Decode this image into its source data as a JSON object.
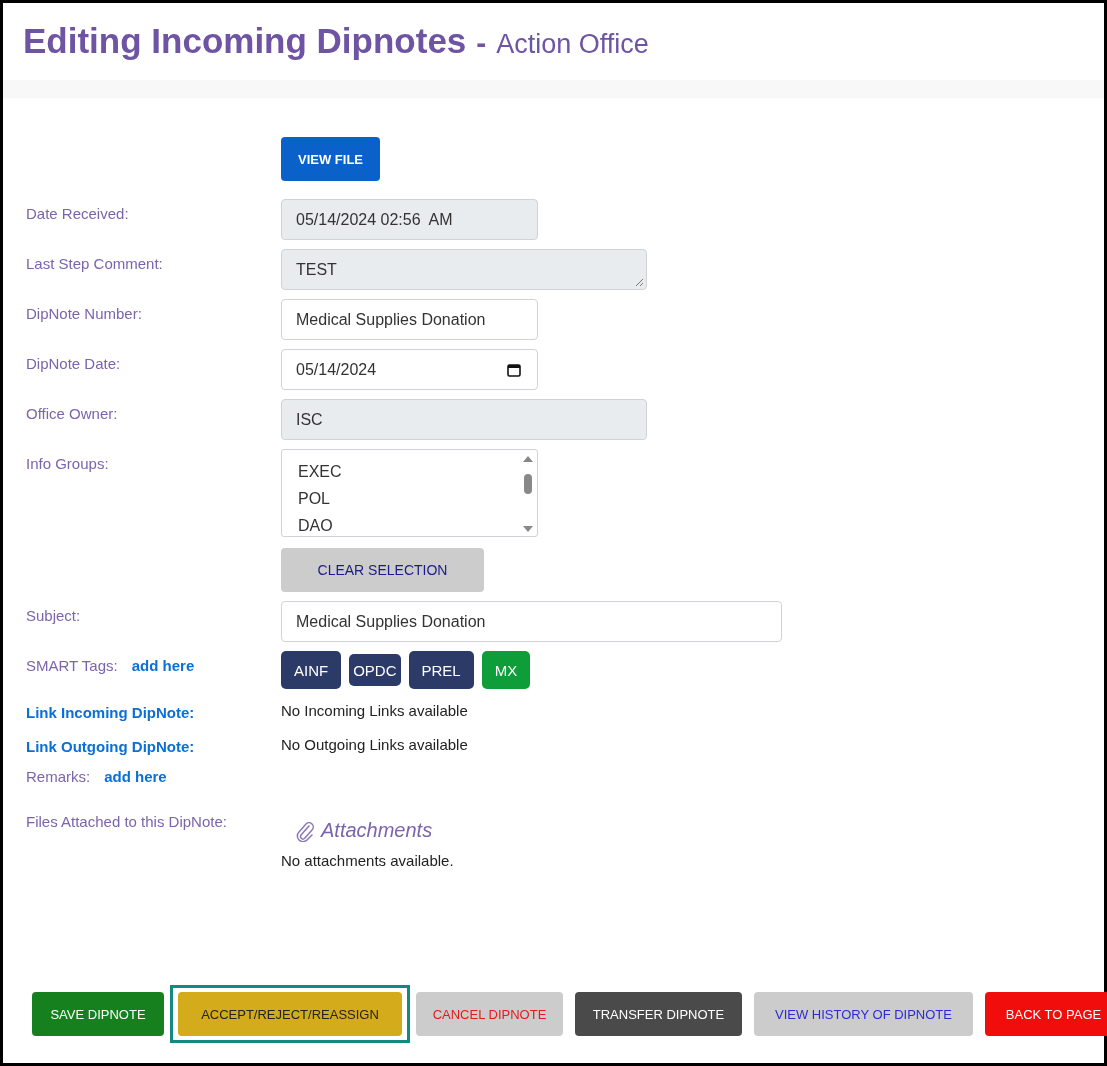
{
  "title": {
    "main": "Editing Incoming Dipnotes",
    "separator": "-",
    "sub": "Action Office"
  },
  "view_file_button": "VIEW FILE",
  "fields": [
    {
      "label": "Date Received:",
      "kind": "stamp",
      "value": "05/14/2024 02:56  AM"
    },
    {
      "label": "Last Step Comment:",
      "kind": "comment",
      "value": "TEST"
    },
    {
      "label": "DipNote Number:",
      "kind": "text",
      "value": "Medical Supplies Donation"
    },
    {
      "label": "DipNote Date:",
      "kind": "date",
      "value": "05/14/2024"
    },
    {
      "label": "Office Owner:",
      "kind": "locked",
      "value": "ISC"
    }
  ],
  "info_groups": {
    "label": "Info Groups:",
    "options": [
      "EXEC",
      "POL",
      "DAO"
    ],
    "clear_button": "CLEAR SELECTION"
  },
  "subject": {
    "label": "Subject:",
    "value": "Medical Supplies Donation"
  },
  "smart_tags": {
    "label": "SMART Tags:",
    "link": "add here",
    "tags": [
      {
        "text": "AINF",
        "color": "#2b3a67"
      },
      {
        "text": "OPDC",
        "color": "#2b3a67"
      },
      {
        "text": "PREL",
        "color": "#2b3a67"
      },
      {
        "text": "MX",
        "color": "#0f9d3a"
      }
    ]
  },
  "links": [
    {
      "label": "Link Incoming DipNote:",
      "value": "No Incoming Links available"
    },
    {
      "label": "Link Outgoing DipNote:",
      "value": "No Outgoing Links available"
    }
  ],
  "remarks": {
    "label": "Remarks:",
    "link": "add here"
  },
  "files": {
    "label": "Files Attached to this DipNote:",
    "heading": "Attachments",
    "empty": "No attachments available."
  },
  "actions": [
    {
      "label": "SAVE DIPNOTE",
      "kind": "save",
      "highlighted": false
    },
    {
      "label": "ACCEPT/REJECT/REASSIGN",
      "kind": "accept",
      "highlighted": true
    },
    {
      "label": "CANCEL DIPNOTE",
      "kind": "cancel",
      "highlighted": false
    },
    {
      "label": "TRANSFER DIPNOTE",
      "kind": "transfer",
      "highlighted": false
    },
    {
      "label": "VIEW HISTORY OF DIPNOTE",
      "kind": "history",
      "highlighted": false
    },
    {
      "label": "BACK TO PAGE",
      "kind": "back",
      "highlighted": false
    }
  ]
}
